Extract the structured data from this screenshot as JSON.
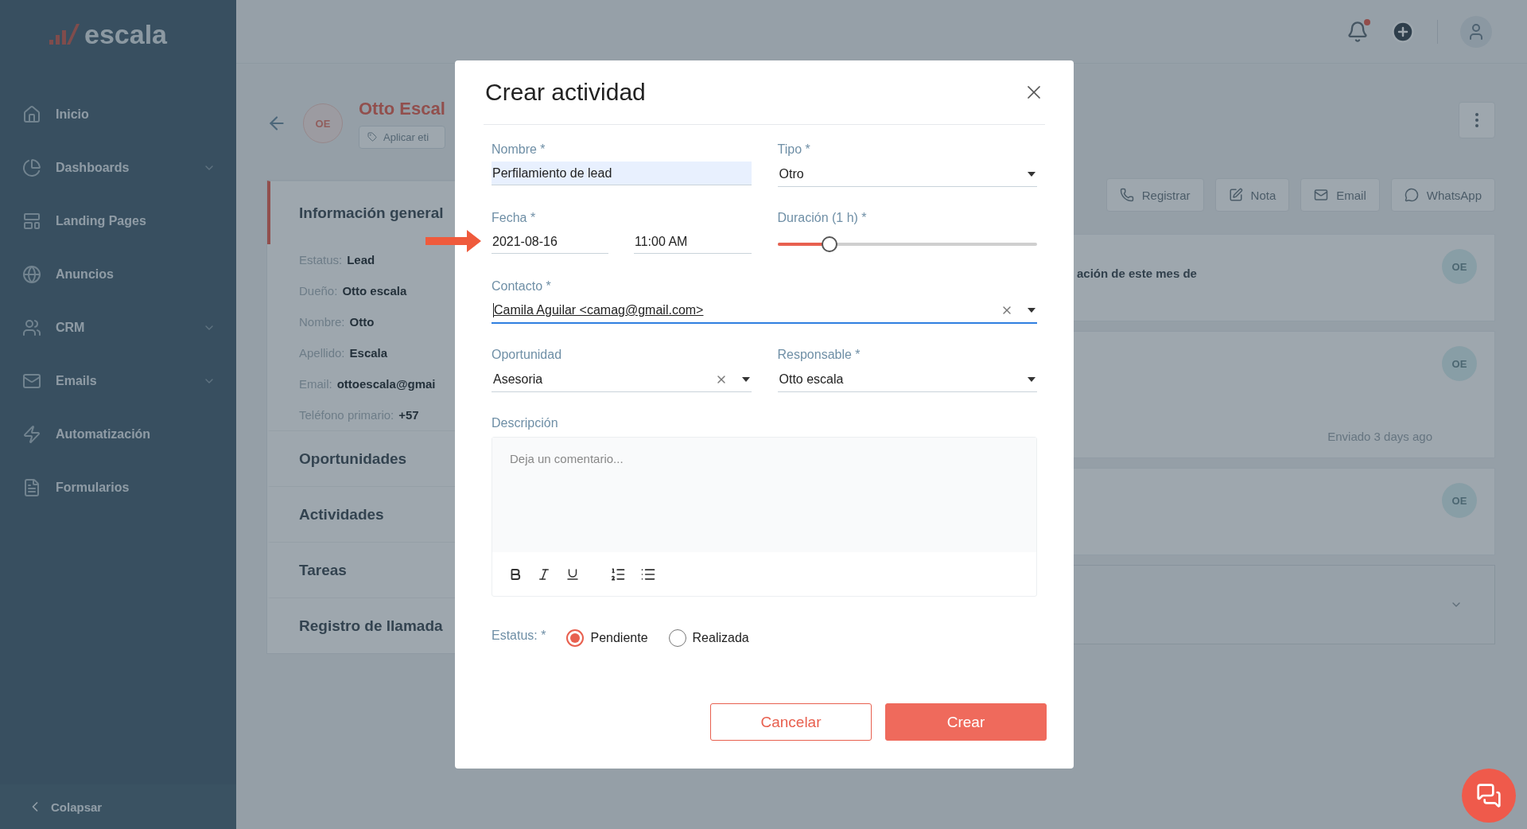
{
  "sidebar": {
    "logo": "escala",
    "items": [
      {
        "label": "Inicio",
        "expandable": false
      },
      {
        "label": "Dashboards",
        "expandable": true
      },
      {
        "label": "Landing Pages",
        "expandable": false
      },
      {
        "label": "Anuncios",
        "expandable": false
      },
      {
        "label": "CRM",
        "expandable": true
      },
      {
        "label": "Emails",
        "expandable": true
      },
      {
        "label": "Automatización",
        "expandable": false
      },
      {
        "label": "Formularios",
        "expandable": false
      }
    ],
    "collapse": "Colapsar"
  },
  "topbar": {
    "has_notification": true
  },
  "contact": {
    "initials": "OE",
    "name": "Otto Escal",
    "tag_button": "Aplicar eti"
  },
  "sections": [
    {
      "title": "Información general",
      "selected": true,
      "fields": [
        {
          "label": "Estatus:",
          "value": "Lead"
        },
        {
          "label": "Dueño:",
          "value": "Otto escala"
        },
        {
          "label": "Nombre:",
          "value": "Otto"
        },
        {
          "label": "Apellido:",
          "value": "Escala"
        },
        {
          "label": "Email:",
          "value": "ottoescala@gmai"
        },
        {
          "label": "Teléfono primario:",
          "value": "+57"
        }
      ]
    },
    {
      "title": "Oportunidades",
      "selected": false
    },
    {
      "title": "Actividades",
      "selected": false
    },
    {
      "title": "Tareas",
      "selected": false
    },
    {
      "title": "Registro de llamada",
      "selected": false
    }
  ],
  "actions": [
    "Registrar",
    "Nota",
    "Email",
    "WhatsApp"
  ],
  "feed": [
    {
      "initials": "OE",
      "text": "ación de este mes de"
    },
    {
      "initials": "OE",
      "meta": "Enviado 3 days ago"
    },
    {
      "initials": "OE"
    }
  ],
  "modal": {
    "title": "Crear actividad",
    "rows": [
      [
        {
          "kind": "text",
          "label": "Nombre *",
          "value": "Perfilamiento de lead",
          "highlighted": true
        },
        {
          "kind": "select",
          "label": "Tipo *",
          "value": "Otro",
          "focused": false
        }
      ],
      [
        {
          "kind": "datetime",
          "label": "Fecha *",
          "date": "2021-08-16",
          "time": "11:00 AM"
        },
        {
          "kind": "slider",
          "label": "Duración (1 h) *",
          "level": 0.2
        }
      ],
      [
        {
          "kind": "select",
          "label": "Contacto *",
          "value": "Camila Aguilar <camag@gmail.com>",
          "clearable": true,
          "focused": true
        }
      ],
      [
        {
          "kind": "select",
          "label": "Oportunidad",
          "value": "Asesoria",
          "clearable": true,
          "focused": false
        },
        {
          "kind": "select",
          "label": "Responsable *",
          "value": "Otto escala",
          "focused": false
        }
      ]
    ],
    "description": {
      "label": "Descripción",
      "placeholder": "Deja un comentario..."
    },
    "status": {
      "label": "Estatus: *",
      "options": [
        {
          "label": "Pendiente",
          "selected": true
        },
        {
          "label": "Realizada",
          "selected": false
        }
      ]
    },
    "buttons": [
      {
        "label": "Cancelar",
        "kind": "secondary"
      },
      {
        "label": "Crear",
        "kind": "primary"
      }
    ]
  }
}
